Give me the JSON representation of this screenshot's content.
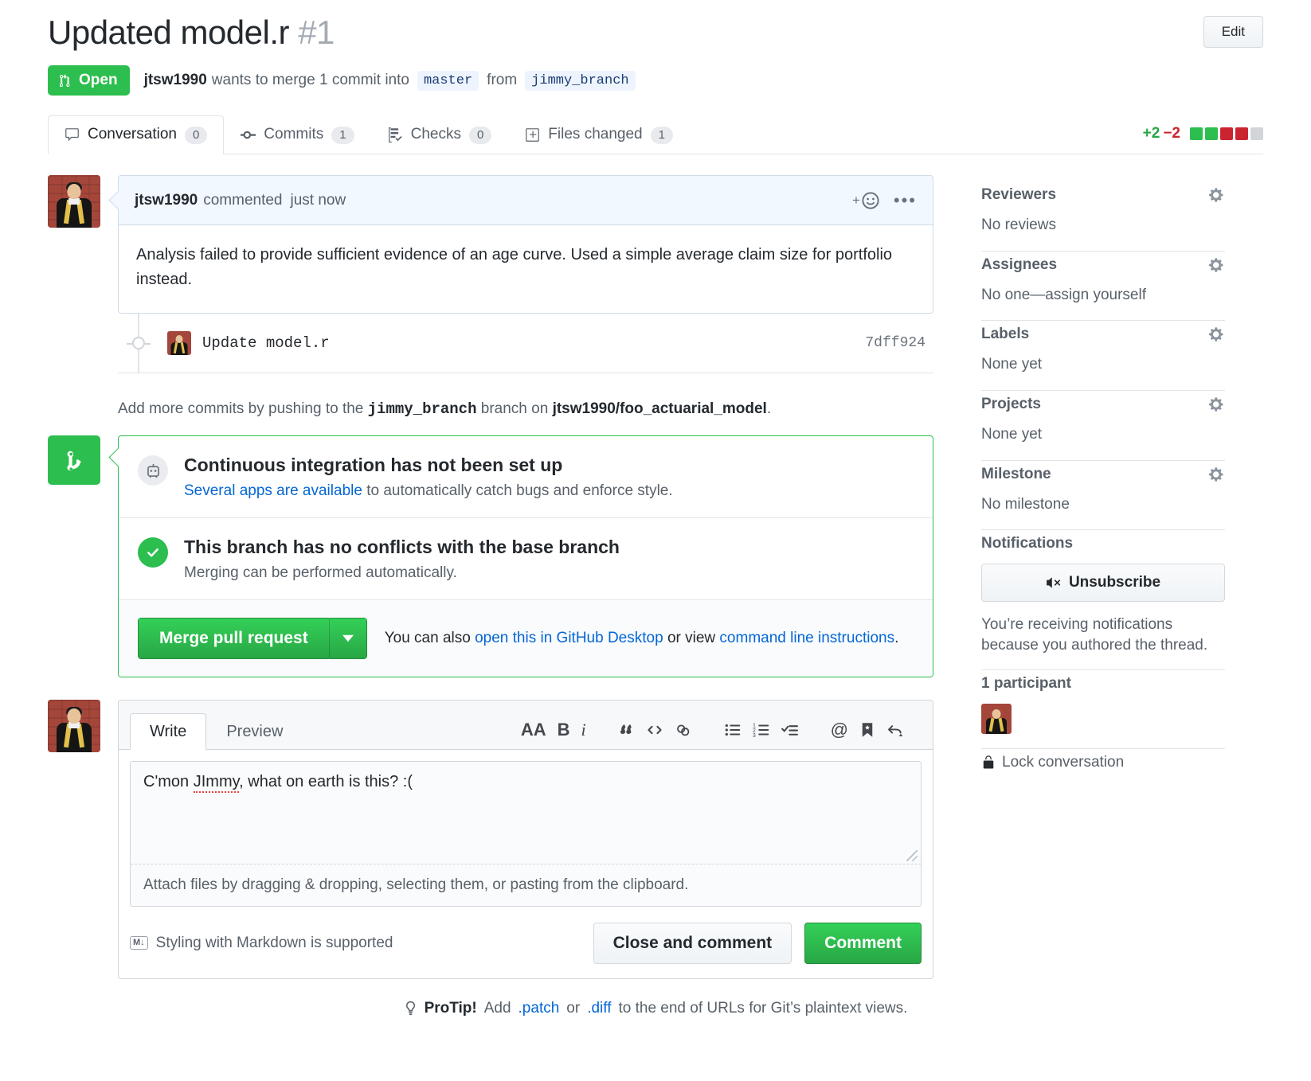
{
  "header": {
    "title": "Updated model.r",
    "number": "#1",
    "edit_label": "Edit",
    "state": "Open",
    "author": "jtsw1990",
    "merge_sentence_1": "wants to merge 1 commit into",
    "base_branch": "master",
    "merge_sentence_2": "from",
    "head_branch": "jimmy_branch"
  },
  "tabs": [
    {
      "label": "Conversation",
      "count": "0",
      "icon": "comment-icon"
    },
    {
      "label": "Commits",
      "count": "1",
      "icon": "commit-icon"
    },
    {
      "label": "Checks",
      "count": "0",
      "icon": "checks-icon"
    },
    {
      "label": "Files changed",
      "count": "1",
      "icon": "file-icon"
    }
  ],
  "diffstat": {
    "additions": "+2",
    "deletions": "−2",
    "blocks": [
      "g",
      "g",
      "r",
      "r",
      "n"
    ],
    "color_add": "#28a745",
    "color_del": "#cb2431"
  },
  "comment": {
    "author": "jtsw1990",
    "action": "commented",
    "time": "just now",
    "body": "Analysis failed to provide sufficient evidence of an age curve. Used a simple average claim size for portfolio instead."
  },
  "commit": {
    "message": "Update model.r",
    "sha": "7dff924"
  },
  "push_note": {
    "prefix": "Add more commits by pushing to the",
    "branch": "jimmy_branch",
    "middle": "branch on",
    "repo": "jtsw1990/foo_actuarial_model",
    "suffix": "."
  },
  "merge_status": {
    "ci": {
      "title": "Continuous integration has not been set up",
      "link": "Several apps are available",
      "rest": " to automatically catch bugs and enforce style."
    },
    "conflict": {
      "title": "This branch has no conflicts with the base branch",
      "sub": "Merging can be performed automatically."
    },
    "merge_button": "Merge pull request",
    "hint_prefix": "You can also ",
    "hint_link_1": "open this in GitHub Desktop",
    "hint_middle": " or view ",
    "hint_link_2": "command line instructions",
    "hint_suffix": "."
  },
  "form": {
    "tabs": {
      "write": "Write",
      "preview": "Preview"
    },
    "toolbar": [
      {
        "name": "heading-icon",
        "label": "AA"
      },
      {
        "name": "bold-icon",
        "label": "B"
      },
      {
        "name": "italic-icon",
        "label": "i"
      },
      {
        "name": "quote-icon",
        "label": "“"
      },
      {
        "name": "code-icon",
        "label": "<>"
      },
      {
        "name": "link-icon",
        "label": "link"
      },
      {
        "name": "unordered-list-icon",
        "label": "list"
      },
      {
        "name": "ordered-list-icon",
        "label": "numlist"
      },
      {
        "name": "task-list-icon",
        "label": "tasklist"
      },
      {
        "name": "mention-icon",
        "label": "@"
      },
      {
        "name": "saved-reply-icon",
        "label": "bookmark"
      },
      {
        "name": "reply-icon",
        "label": "reply"
      }
    ],
    "comment_text_before": "C'mon ",
    "comment_text_misspelled": "JImmy",
    "comment_text_after": ", what on earth is this? :(",
    "attach_hint": "Attach files by dragging & dropping, selecting them, or pasting from the clipboard.",
    "markdown_note": "Styling with Markdown is supported",
    "markdown_badge": "M↓",
    "close_button": "Close and comment",
    "comment_button": "Comment"
  },
  "sidebar": {
    "sections": [
      {
        "title": "Reviewers",
        "value": "No reviews",
        "gear": true
      },
      {
        "title": "Assignees",
        "value": "No one—assign yourself",
        "gear": true
      },
      {
        "title": "Labels",
        "value": "None yet",
        "gear": true
      },
      {
        "title": "Projects",
        "value": "None yet",
        "gear": true
      },
      {
        "title": "Milestone",
        "value": "No milestone",
        "gear": true
      }
    ],
    "notifications": {
      "title": "Notifications",
      "button": "Unsubscribe",
      "note": "You’re receiving notifications because you authored the thread."
    },
    "participants": {
      "title": "1 participant"
    },
    "lock": "Lock conversation"
  },
  "protip": {
    "label": "ProTip!",
    "before": " Add ",
    "link1": ".patch",
    "middle": " or ",
    "link2": ".diff",
    "after": " to the end of URLs for Git’s plaintext views."
  }
}
